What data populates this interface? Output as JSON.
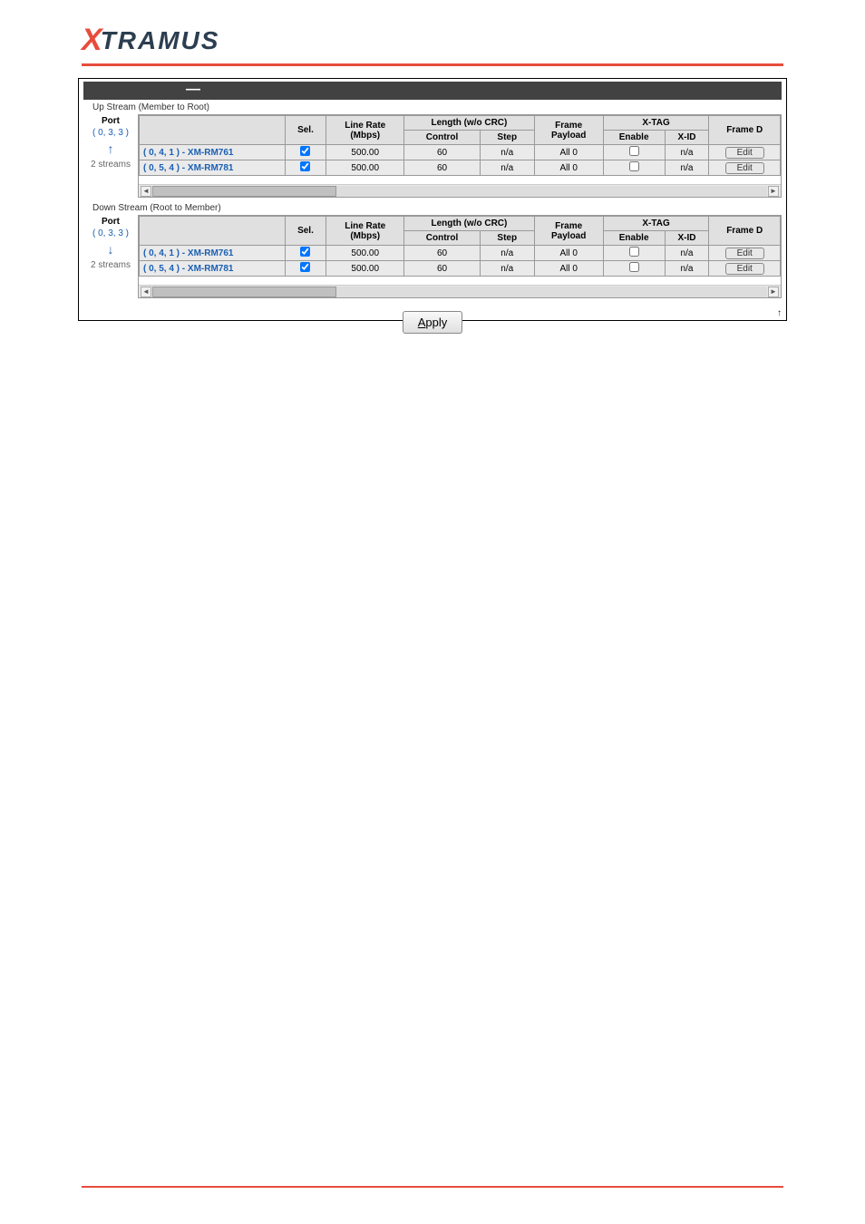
{
  "logo": {
    "x": "X",
    "text": "TRAMUS"
  },
  "panel": {
    "upLabel": "Up Stream (Member to Root)",
    "downLabel": "Down Stream (Root to Member)"
  },
  "headers": {
    "port": "Port",
    "sel": "Sel.",
    "lineRate": "Line Rate\n(Mbps)",
    "lengthGroup": "Length (w/o CRC)",
    "control": "Control",
    "step": "Step",
    "framePayload": "Frame\nPayload",
    "xtagGroup": "X-TAG",
    "enable": "Enable",
    "xid": "X-ID",
    "frameD": "Frame D",
    "editLabel": "Edit"
  },
  "up": {
    "port": "( 0, 3, 3 )",
    "streams": "2 streams",
    "arrow": "↑",
    "rows": [
      {
        "device": "( 0, 4, 1 ) - XM-RM761",
        "sel": true,
        "rate": "500.00",
        "control": "60",
        "step": "n/a",
        "payload": "All 0",
        "enable": false,
        "xid": "n/a"
      },
      {
        "device": "( 0, 5, 4 ) - XM-RM781",
        "sel": true,
        "rate": "500.00",
        "control": "60",
        "step": "n/a",
        "payload": "All 0",
        "enable": false,
        "xid": "n/a"
      }
    ]
  },
  "down": {
    "port": "( 0, 3, 3 )",
    "streams": "2 streams",
    "arrow": "↓",
    "rows": [
      {
        "device": "( 0, 4, 1 ) - XM-RM761",
        "sel": true,
        "rate": "500.00",
        "control": "60",
        "step": "n/a",
        "payload": "All 0",
        "enable": false,
        "xid": "n/a"
      },
      {
        "device": "( 0, 5, 4 ) - XM-RM781",
        "sel": true,
        "rate": "500.00",
        "control": "60",
        "step": "n/a",
        "payload": "All 0",
        "enable": false,
        "xid": "n/a"
      }
    ]
  },
  "apply": {
    "u": "A",
    "rest": "pply"
  },
  "footerChar": "↑"
}
